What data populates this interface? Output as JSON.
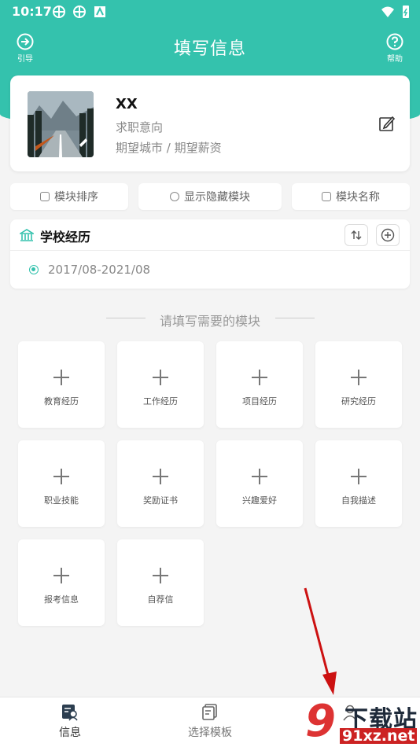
{
  "status_bar": {
    "time": "10:17"
  },
  "header": {
    "title": "填写信息",
    "guide_label": "引导",
    "help_label": "帮助"
  },
  "profile": {
    "name": "XX",
    "job_intent": "求职意向",
    "city_salary": "期望城市 / 期望薪资"
  },
  "actions": [
    {
      "label": "模块排序"
    },
    {
      "label": "显示隐藏模块"
    },
    {
      "label": "模块名称"
    }
  ],
  "school": {
    "title": "学校经历",
    "entry": "2017/08-2021/08"
  },
  "modules_prompt": "请填写需要的模块",
  "modules": [
    {
      "label": "教育经历"
    },
    {
      "label": "工作经历"
    },
    {
      "label": "项目经历"
    },
    {
      "label": "研究经历"
    },
    {
      "label": "职业技能"
    },
    {
      "label": "奖励证书"
    },
    {
      "label": "兴趣爱好"
    },
    {
      "label": "自我描述"
    },
    {
      "label": "报考信息"
    },
    {
      "label": "自荐信"
    }
  ],
  "bottom_nav": [
    {
      "label": "信息"
    },
    {
      "label": "选择模板"
    },
    {
      "label": ""
    }
  ],
  "watermark": {
    "top": "下载站",
    "bottom": "91xz.net",
    "logo": "9"
  },
  "colors": {
    "accent": "#34c2ad",
    "arrow": "#cc1111"
  }
}
